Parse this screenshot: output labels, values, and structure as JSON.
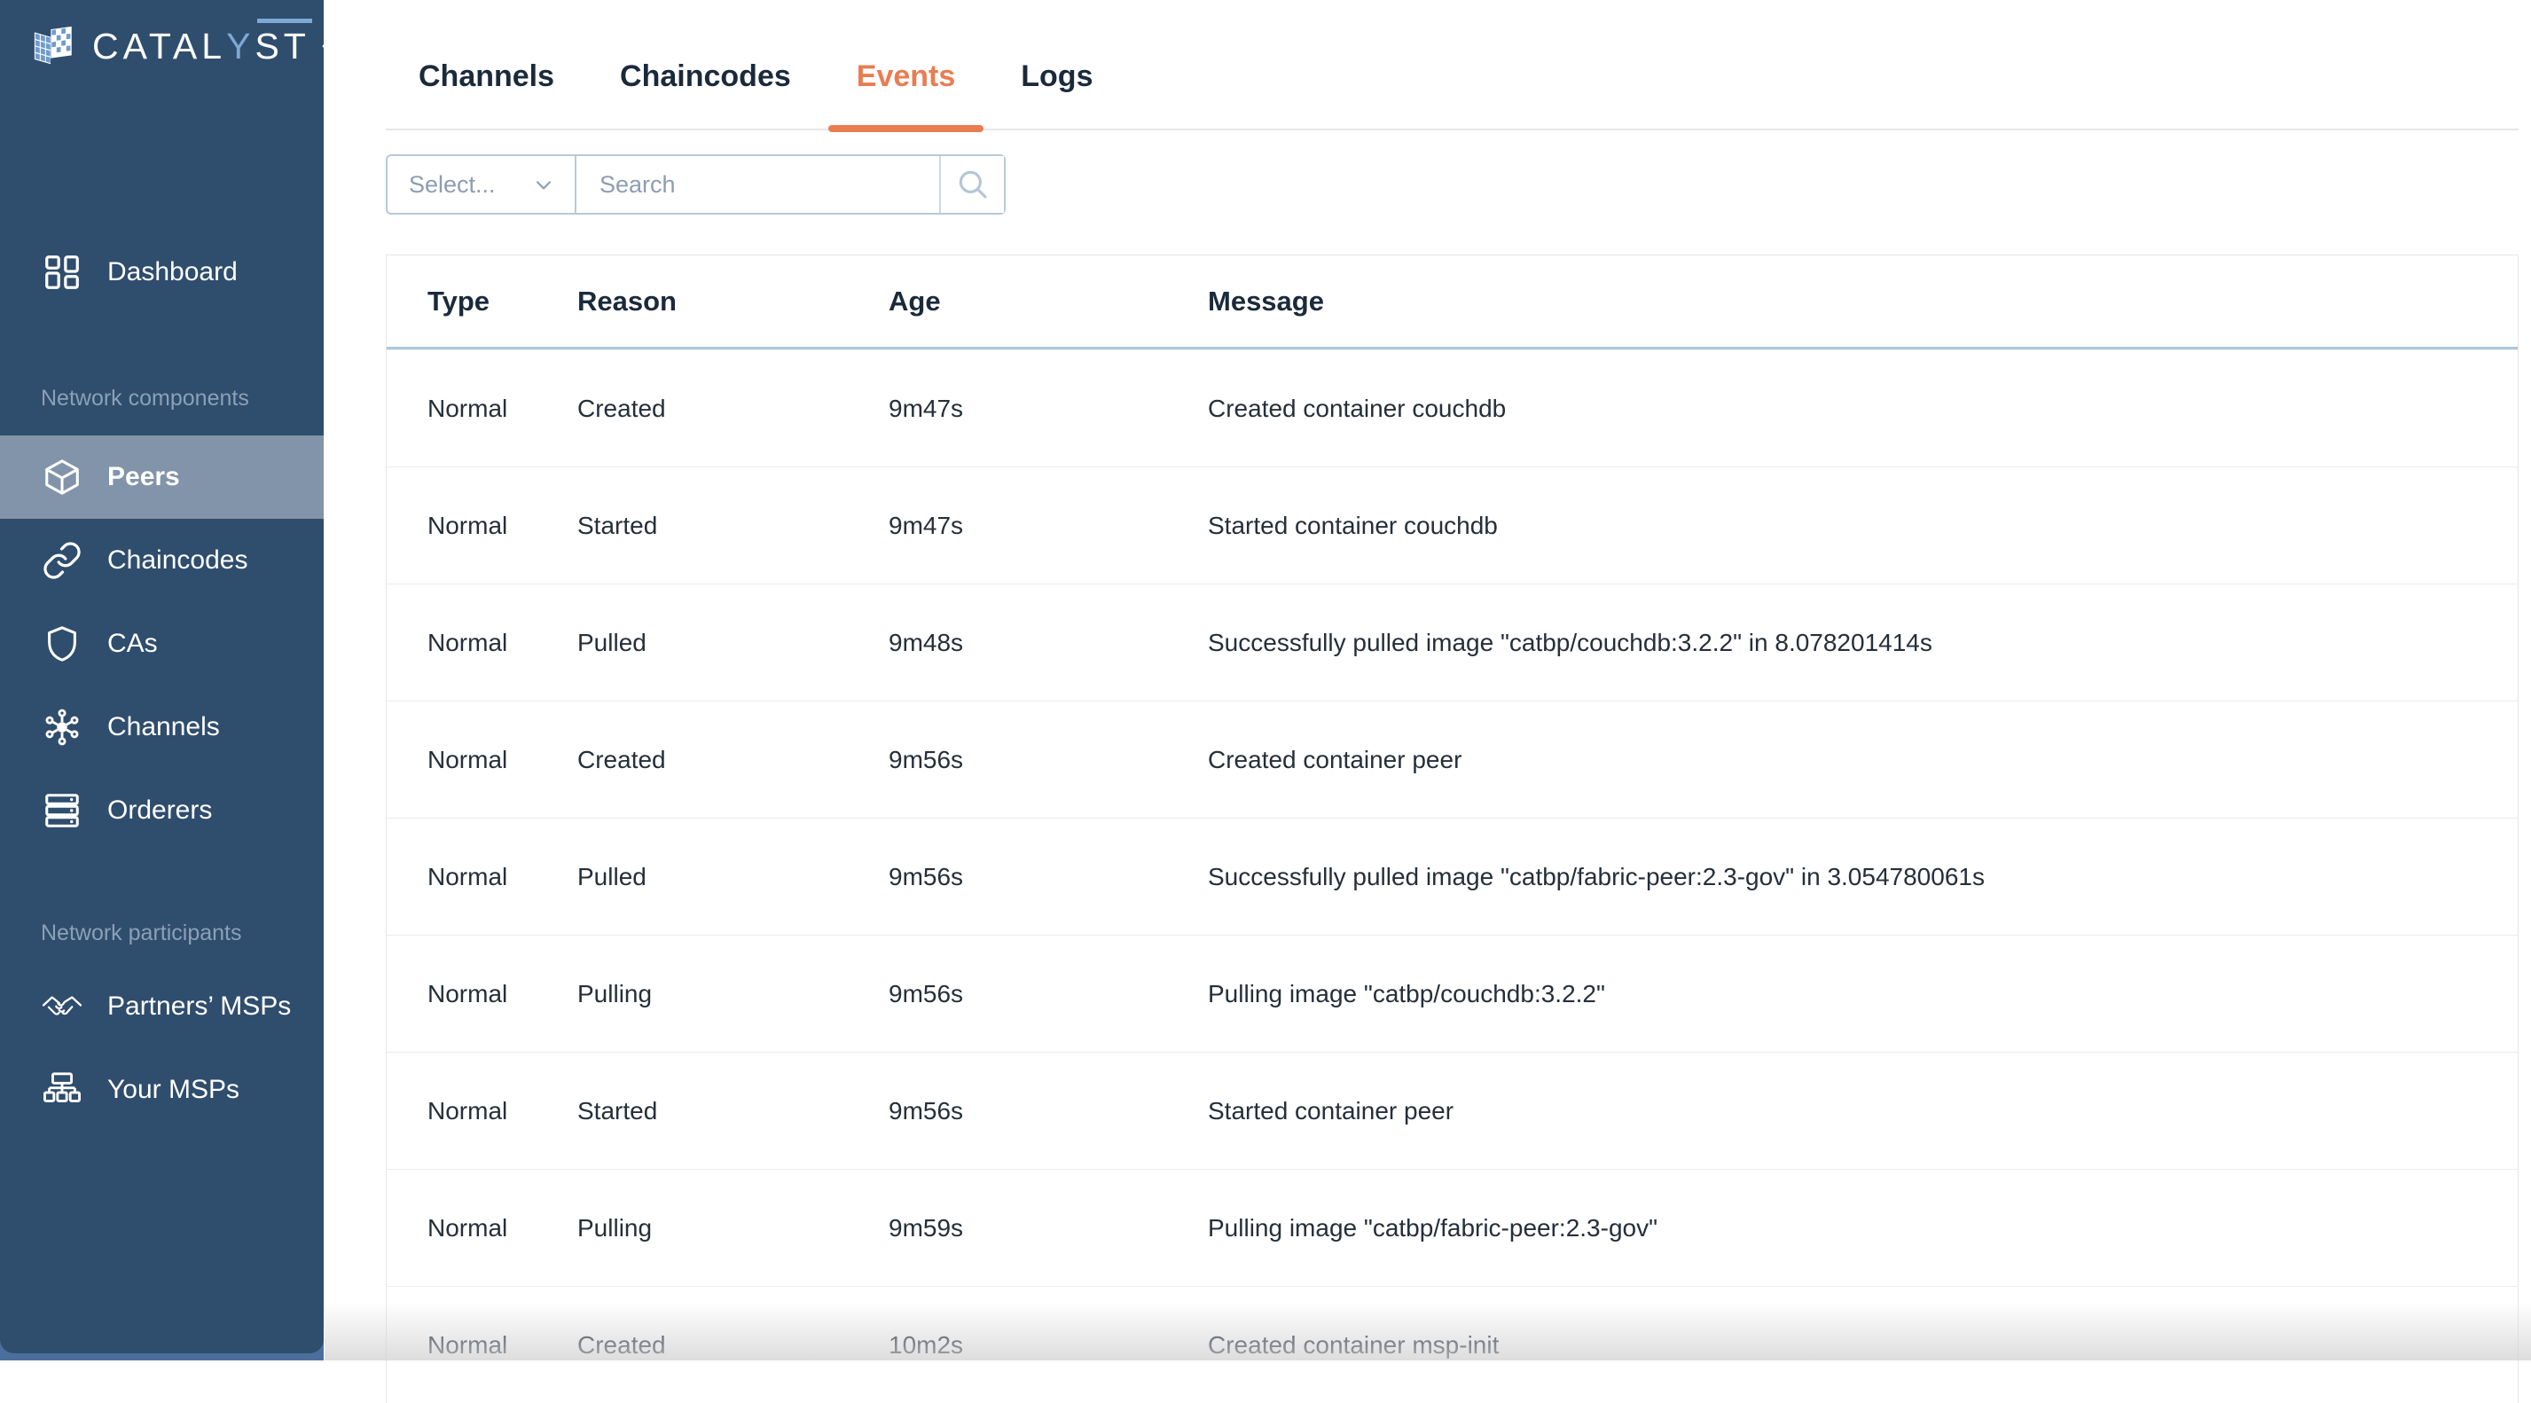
{
  "brand": {
    "logo_part1": "CATAL",
    "logo_part2": "Y",
    "logo_part3": "ST"
  },
  "sidebar": {
    "dashboard": {
      "label": "Dashboard"
    },
    "sections": [
      {
        "title": "Network components",
        "items": [
          {
            "label": "Peers",
            "icon": "cube-icon",
            "active": true
          },
          {
            "label": "Chaincodes",
            "icon": "chain-link-icon",
            "active": false
          },
          {
            "label": "CAs",
            "icon": "shield-icon",
            "active": false
          },
          {
            "label": "Channels",
            "icon": "network-hub-icon",
            "active": false
          },
          {
            "label": "Orderers",
            "icon": "server-stack-icon",
            "active": false
          }
        ]
      },
      {
        "title": "Network participants",
        "items": [
          {
            "label": "Partners’ MSPs",
            "icon": "handshake-icon",
            "active": false
          },
          {
            "label": "Your MSPs",
            "icon": "org-chart-icon",
            "active": false
          }
        ]
      }
    ]
  },
  "tabs": {
    "items": [
      {
        "label": "Channels",
        "active": false
      },
      {
        "label": "Chaincodes",
        "active": false
      },
      {
        "label": "Events",
        "active": true
      },
      {
        "label": "Logs",
        "active": false
      }
    ]
  },
  "filters": {
    "type_select": {
      "placeholder": "Select..."
    },
    "search": {
      "placeholder": "Search"
    }
  },
  "table": {
    "columns": [
      "Type",
      "Reason",
      "Age",
      "Message"
    ],
    "rows": [
      {
        "type": "Normal",
        "reason": "Created",
        "age": "9m47s",
        "message": "Created container couchdb"
      },
      {
        "type": "Normal",
        "reason": "Started",
        "age": "9m47s",
        "message": "Started container couchdb"
      },
      {
        "type": "Normal",
        "reason": "Pulled",
        "age": "9m48s",
        "message": "Successfully pulled image \"catbp/couchdb:3.2.2\" in 8.078201414s"
      },
      {
        "type": "Normal",
        "reason": "Created",
        "age": "9m56s",
        "message": "Created container peer"
      },
      {
        "type": "Normal",
        "reason": "Pulled",
        "age": "9m56s",
        "message": "Successfully pulled image \"catbp/fabric-peer:2.3-gov\" in 3.054780061s"
      },
      {
        "type": "Normal",
        "reason": "Pulling",
        "age": "9m56s",
        "message": "Pulling image \"catbp/couchdb:3.2.2\""
      },
      {
        "type": "Normal",
        "reason": "Started",
        "age": "9m56s",
        "message": "Started container peer"
      },
      {
        "type": "Normal",
        "reason": "Pulling",
        "age": "9m59s",
        "message": "Pulling image \"catbp/fabric-peer:2.3-gov\""
      },
      {
        "type": "Normal",
        "reason": "Created",
        "age": "10m2s",
        "message": "Created container msp-init"
      }
    ]
  },
  "colors": {
    "sidebar_bg": "#2F4D6D",
    "sidebar_base": "#4C6E9C",
    "sidebar_active_bg": "#8294A9",
    "accent_orange": "#EA7C52",
    "logo_blue": "#7FA8D4",
    "header_underline": "#ACC7DB",
    "input_border": "#B9C9DA",
    "text_navy": "#1B2A3B"
  }
}
